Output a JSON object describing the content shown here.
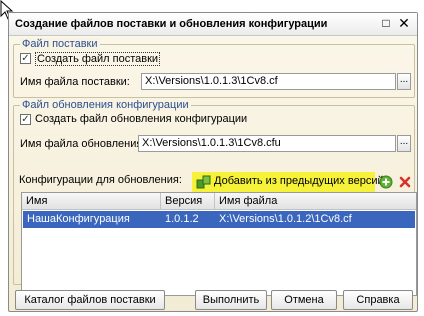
{
  "window": {
    "title": "Создание файлов поставки и обновления конфигурации",
    "maximize_glyph": "□",
    "close_glyph": "✕"
  },
  "delivery_group": {
    "legend": "Файл поставки",
    "checkbox_label": "Создать файл поставки",
    "checked": true,
    "file_label": "Имя файла поставки:",
    "file_value": "X:\\Versions\\1.0.1.3\\1Cv8.cf",
    "browse_label": "..."
  },
  "update_group": {
    "legend": "Файл обновления конфигурации",
    "checkbox_label": "Создать файл обновления конфигурации",
    "checked": true,
    "file_label": "Имя файла обновления:",
    "file_value": "X:\\Versions\\1.0.1.3\\1Cv8.cfu",
    "browse_label": "...",
    "configs_label": "Конфигурации для обновления:",
    "add_previous_label": "Добавить из предыдущих версий",
    "icons": [
      "add-previous-versions-icon",
      "add-icon",
      "delete-icon"
    ],
    "highlight_color": "#f6f23a",
    "table": {
      "columns": [
        "Имя",
        "Версия",
        "Имя файла"
      ],
      "rows": [
        {
          "name": "НашаКонфигурация",
          "version": "1.0.1.2",
          "file": "X:\\Versions\\1.0.1.2\\1Cv8.cf"
        }
      ]
    }
  },
  "footer": {
    "catalog_label": "Каталог файлов поставки",
    "run_label": "Выполнить",
    "cancel_label": "Отмена",
    "help_label": "Справка"
  },
  "colors": {
    "accent": "#2d4f91",
    "selected_row": "#3a66bd",
    "window_bg": "#f8f3e2"
  }
}
